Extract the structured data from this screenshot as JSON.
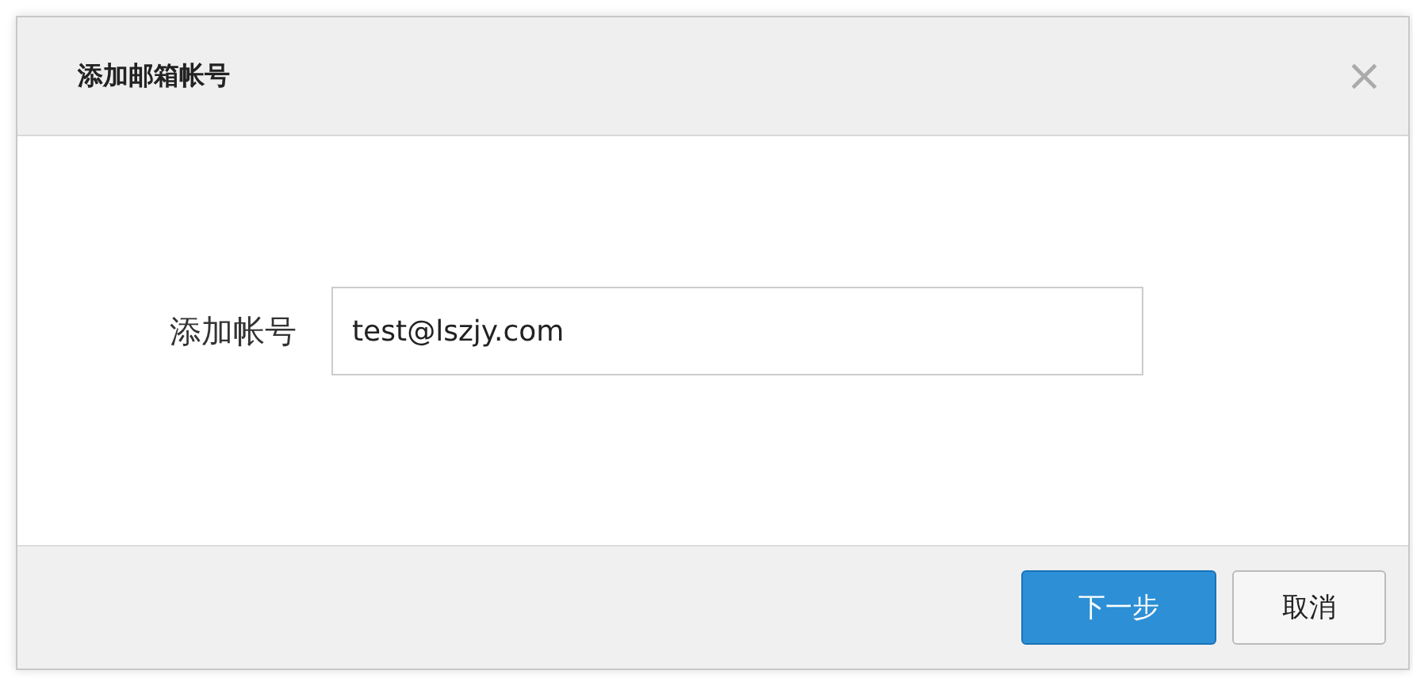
{
  "dialog": {
    "title": "添加邮箱帐号",
    "close": "×"
  },
  "form": {
    "label": "添加帐号",
    "value": "test@lszjy.com"
  },
  "buttons": [
    {
      "label": "下一步",
      "kind": "primary"
    },
    {
      "label": "取消",
      "kind": "default"
    }
  ]
}
